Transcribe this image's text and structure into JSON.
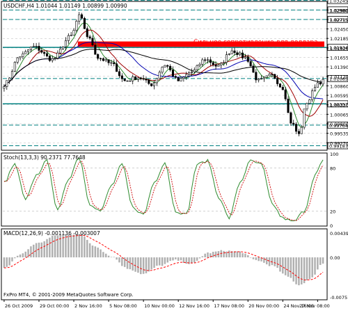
{
  "window": {
    "symbol_title": "USDCHF,H4 1.01044 1.01149 1.00899 1.00990",
    "copyright": "FxPro MT4, © 2001-2009 MetaQuotes Software Corp."
  },
  "colors": {
    "background": "#ffffff",
    "grid": "#b8b8b8",
    "candle": "#000000",
    "ma_fast": "#2e8b2e",
    "ma_mid": "#a00000",
    "ma_slow": "#0000b0",
    "ma_long": "#000000",
    "resistance_zone": "#ff0000",
    "level_line": "#008080",
    "stoch_main": "#2e8b2e",
    "stoch_signal": "#cc0000",
    "macd_hist": "#b0b0b0",
    "macd_signal": "#ff0000",
    "axis_text": "#000000"
  },
  "annotation": "Сильное сопротивление для доллара",
  "x_labels": [
    "26 Oct 2009",
    "29 Oct 00:00",
    "2 Nov 16:00",
    "5 Nov 08:00",
    "10 Nov 00:00",
    "12 Nov 16:00",
    "17 Nov 08:00",
    "20 Nov 00:00",
    "24 Nov 16:00",
    "27 Nov 08:00"
  ],
  "chart_data": [
    {
      "type": "candlestick",
      "title": "USDCHF,H4 1.01044 1.01149 1.00899 1.00990",
      "ylim": [
        0.991,
        1.032
      ],
      "price_scale_labels": [
        "1.03245",
        "1.02980",
        "1.02715",
        "1.02450",
        "1.02185",
        "1.01920",
        "1.01655",
        "1.01390",
        "1.01125",
        "1.00860",
        "1.00595",
        "1.00330",
        "1.00065",
        "0.99800",
        "0.99535",
        "0.99270",
        "0.99005"
      ],
      "candle_count": 120,
      "close_path_key_points": [
        {
          "i": 0,
          "v": 1.009
        },
        {
          "i": 6,
          "v": 1.017
        },
        {
          "i": 11,
          "v": 1.0195
        },
        {
          "i": 18,
          "v": 1.016
        },
        {
          "i": 25,
          "v": 1.0225
        },
        {
          "i": 28,
          "v": 1.028
        },
        {
          "i": 32,
          "v": 1.0215
        },
        {
          "i": 35,
          "v": 1.0165
        },
        {
          "i": 40,
          "v": 1.0148
        },
        {
          "i": 45,
          "v": 1.01
        },
        {
          "i": 50,
          "v": 1.011
        },
        {
          "i": 55,
          "v": 1.009
        },
        {
          "i": 60,
          "v": 1.0145
        },
        {
          "i": 65,
          "v": 1.01
        },
        {
          "i": 70,
          "v": 1.0125
        },
        {
          "i": 75,
          "v": 1.016
        },
        {
          "i": 80,
          "v": 1.014
        },
        {
          "i": 85,
          "v": 1.0185
        },
        {
          "i": 90,
          "v": 1.0165
        },
        {
          "i": 95,
          "v": 1.01
        },
        {
          "i": 100,
          "v": 1.0115
        },
        {
          "i": 104,
          "v": 1.008
        },
        {
          "i": 107,
          "v": 0.9985
        },
        {
          "i": 110,
          "v": 0.995
        },
        {
          "i": 113,
          "v": 1.004
        },
        {
          "i": 117,
          "v": 1.0095
        },
        {
          "i": 119,
          "v": 1.0099
        }
      ],
      "resistance_zone": {
        "label": "Сильное сопротивление для доллара",
        "price_low": 1.0195,
        "price_high": 1.021,
        "from_index": 28,
        "to_index": 119
      },
      "highlighted_levels": [
        {
          "label": "1.03245",
          "value": 1.03245
        },
        {
          "label": "1.02980",
          "value": 1.0298
        },
        {
          "label": "1.02715",
          "value": 1.02715
        },
        {
          "label": "1.01934",
          "value": 1.01934
        },
        {
          "label": "1.01065",
          "value": 1.01065
        },
        {
          "label": "1.00357",
          "value": 1.00357
        },
        {
          "label": "0.99764",
          "value": 0.99764
        },
        {
          "label": "0.99187",
          "value": 0.99187
        }
      ],
      "moving_averages": [
        {
          "name": "MA fast",
          "color": "#2e8b2e"
        },
        {
          "name": "MA mid",
          "color": "#a00000"
        },
        {
          "name": "MA slow",
          "color": "#0000b0"
        },
        {
          "name": "MA long",
          "color": "#000000"
        }
      ]
    },
    {
      "type": "line",
      "title": "Stoch(13,3,3) 90.2371 77.7648",
      "ylim": [
        0,
        100
      ],
      "y_ticks": [
        100,
        80,
        20,
        0
      ],
      "series": [
        {
          "name": "Main",
          "color": "#2e8b2e"
        },
        {
          "name": "Signal",
          "color": "#cc0000"
        }
      ],
      "main_key_points": [
        {
          "i": 0,
          "v": 60
        },
        {
          "i": 4,
          "v": 85
        },
        {
          "i": 8,
          "v": 35
        },
        {
          "i": 12,
          "v": 70
        },
        {
          "i": 16,
          "v": 90
        },
        {
          "i": 20,
          "v": 20
        },
        {
          "i": 24,
          "v": 65
        },
        {
          "i": 28,
          "v": 95
        },
        {
          "i": 32,
          "v": 30
        },
        {
          "i": 36,
          "v": 20
        },
        {
          "i": 40,
          "v": 55
        },
        {
          "i": 44,
          "v": 85
        },
        {
          "i": 48,
          "v": 25
        },
        {
          "i": 52,
          "v": 15
        },
        {
          "i": 56,
          "v": 60
        },
        {
          "i": 60,
          "v": 88
        },
        {
          "i": 64,
          "v": 20
        },
        {
          "i": 68,
          "v": 15
        },
        {
          "i": 72,
          "v": 85
        },
        {
          "i": 76,
          "v": 90
        },
        {
          "i": 80,
          "v": 40
        },
        {
          "i": 84,
          "v": 10
        },
        {
          "i": 88,
          "v": 60
        },
        {
          "i": 92,
          "v": 90
        },
        {
          "i": 96,
          "v": 85
        },
        {
          "i": 100,
          "v": 30
        },
        {
          "i": 104,
          "v": 10
        },
        {
          "i": 108,
          "v": 5
        },
        {
          "i": 112,
          "v": 20
        },
        {
          "i": 116,
          "v": 70
        },
        {
          "i": 119,
          "v": 90
        }
      ],
      "last_values": {
        "main": 90.2371,
        "signal": 77.7648
      }
    },
    {
      "type": "bar",
      "title": "MACD(12,26,9) -0.001136 -0.003007",
      "ylim": [
        -0.0075,
        0.005
      ],
      "y_ticks": [
        0.00439,
        0.0,
        -0.00751
      ],
      "series": [
        {
          "name": "MACD",
          "color": "#b0b0b0"
        },
        {
          "name": "Signal",
          "color": "#ff0000"
        }
      ],
      "hist_key_points": [
        {
          "i": 0,
          "v": -0.002
        },
        {
          "i": 6,
          "v": 0.0005
        },
        {
          "i": 12,
          "v": 0.0025
        },
        {
          "i": 20,
          "v": 0.004
        },
        {
          "i": 28,
          "v": 0.0042
        },
        {
          "i": 34,
          "v": 0.002
        },
        {
          "i": 40,
          "v": 0.0002
        },
        {
          "i": 46,
          "v": -0.002
        },
        {
          "i": 52,
          "v": -0.003
        },
        {
          "i": 58,
          "v": -0.0015
        },
        {
          "i": 64,
          "v": -0.0005
        },
        {
          "i": 70,
          "v": -0.0012
        },
        {
          "i": 76,
          "v": 0.0008
        },
        {
          "i": 82,
          "v": 0.0012
        },
        {
          "i": 88,
          "v": 0.001
        },
        {
          "i": 94,
          "v": -0.0005
        },
        {
          "i": 100,
          "v": -0.0015
        },
        {
          "i": 106,
          "v": -0.0035
        },
        {
          "i": 110,
          "v": -0.005
        },
        {
          "i": 114,
          "v": -0.004
        },
        {
          "i": 119,
          "v": -0.0011
        }
      ],
      "last_values": {
        "macd": -0.001136,
        "signal": -0.003007
      }
    }
  ]
}
